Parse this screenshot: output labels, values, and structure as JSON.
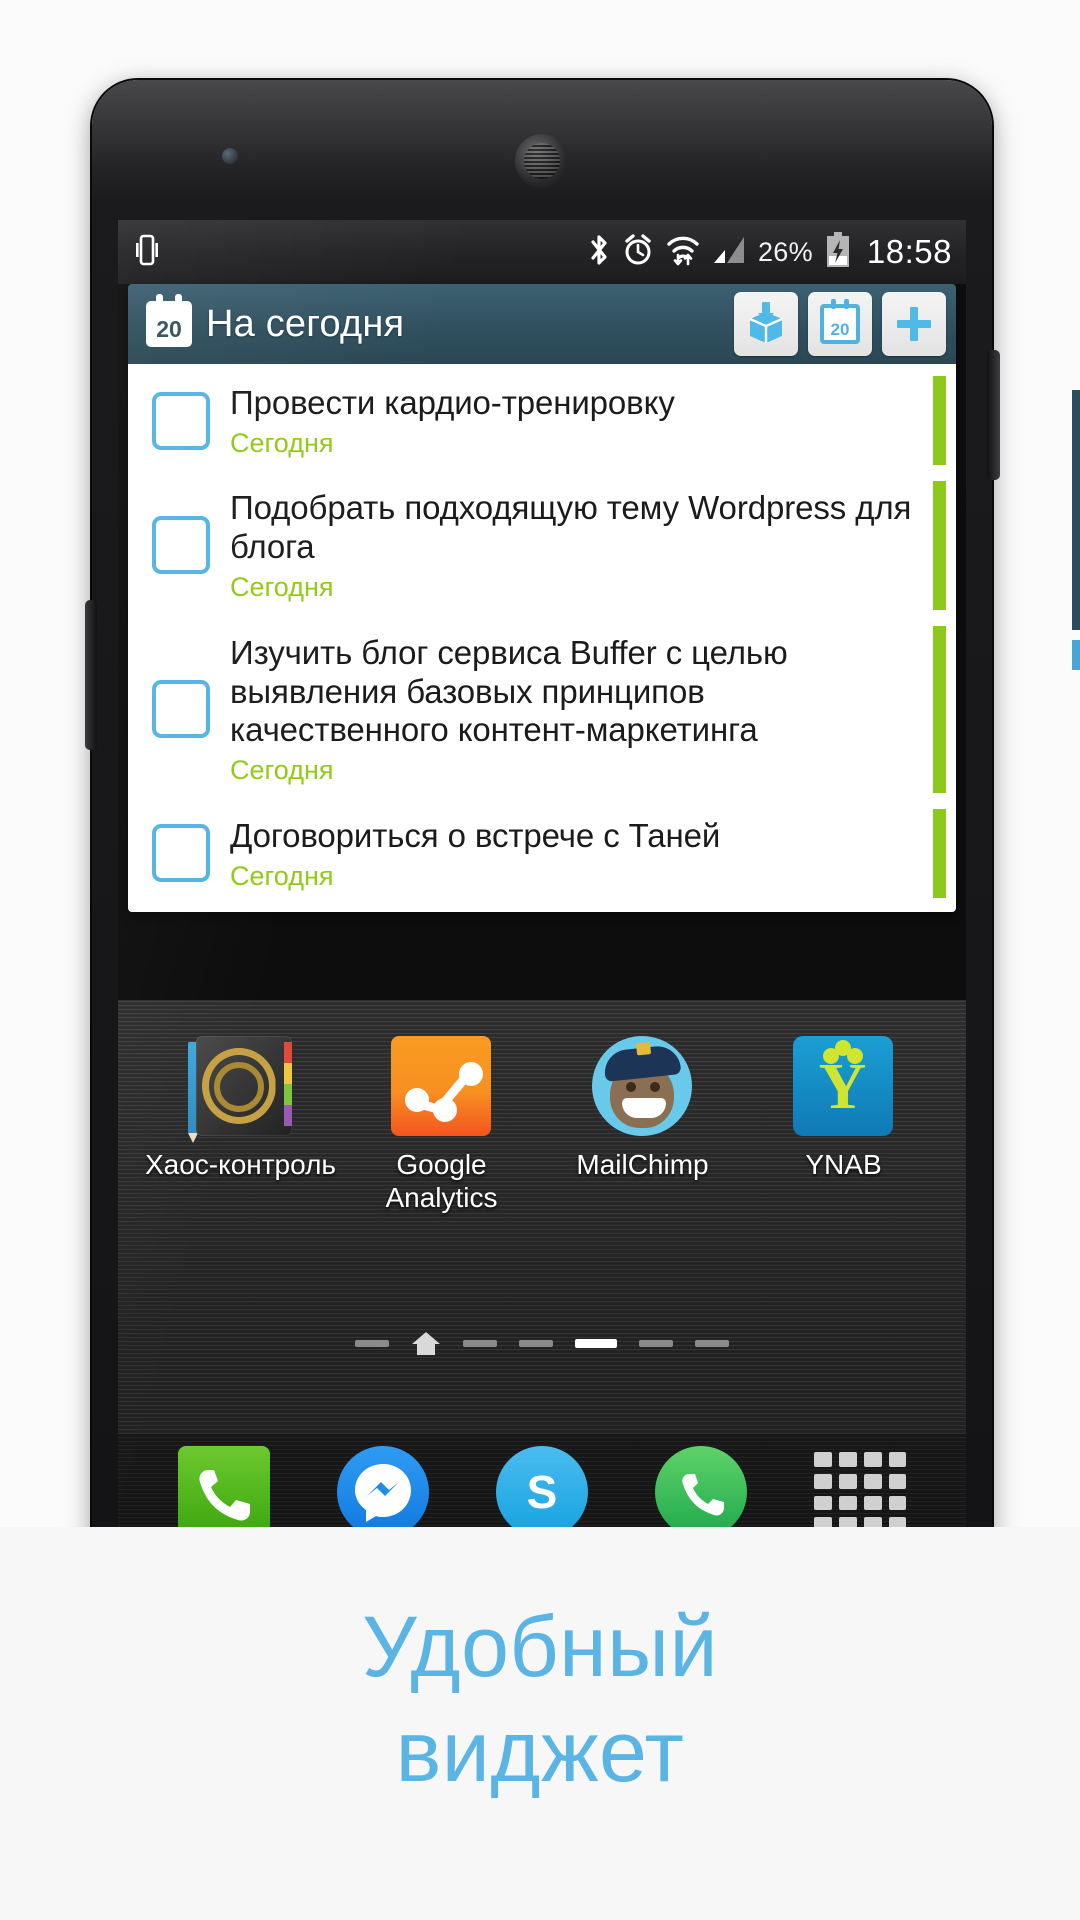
{
  "statusbar": {
    "left_icons": [
      "vibrate-icon"
    ],
    "right_icons": [
      "bluetooth-icon",
      "alarm-icon",
      "wifi-icon",
      "signal-icon",
      "battery-charging-icon"
    ],
    "battery_percent": "26%",
    "time": "18:58"
  },
  "widget": {
    "calendar_day": "20",
    "title": "На сегодня",
    "buttons": [
      {
        "name": "inbox-button",
        "icon": "inbox-icon"
      },
      {
        "name": "today-button",
        "icon": "calendar-icon",
        "day": "20"
      },
      {
        "name": "add-task-button",
        "icon": "plus-icon"
      }
    ],
    "tasks": [
      {
        "title": "Провести кардио-тренировку",
        "due": "Сегодня",
        "checked": false
      },
      {
        "title": "Подобрать подходящую тему Wordpress для блога",
        "due": "Сегодня",
        "checked": false
      },
      {
        "title": "Изучить блог сервиса Buffer с целью выявления базовых принципов качественного контент-маркетинга",
        "due": "Сегодня",
        "checked": false
      },
      {
        "title": "Договориться о встрече с Таней",
        "due": "Сегодня",
        "checked": false
      }
    ]
  },
  "homescreen": {
    "apps": [
      {
        "label": "Хаос-контроль",
        "icon": "chaos-control-icon"
      },
      {
        "label": "Google Analytics",
        "icon": "google-analytics-icon"
      },
      {
        "label": "MailChimp",
        "icon": "mailchimp-icon"
      },
      {
        "label": "YNAB",
        "icon": "ynab-icon"
      }
    ],
    "pager": {
      "total": 7,
      "active_index": 4,
      "home_index": 1
    },
    "dock": [
      {
        "name": "phone-app",
        "icon": "phone-icon"
      },
      {
        "name": "messenger-app",
        "icon": "messenger-icon"
      },
      {
        "name": "skype-app",
        "icon": "skype-icon"
      },
      {
        "name": "whatsapp-app",
        "icon": "whatsapp-icon"
      },
      {
        "name": "app-drawer",
        "icon": "grid-icon"
      }
    ]
  },
  "caption": {
    "line1": "Удобный",
    "line2": "виджет"
  },
  "colors": {
    "accent_blue": "#5ab4e4",
    "checkbox_blue": "#54b3e4",
    "due_green": "#93c917",
    "bar_green": "#8cc81e",
    "header_teal": "#30505f"
  }
}
